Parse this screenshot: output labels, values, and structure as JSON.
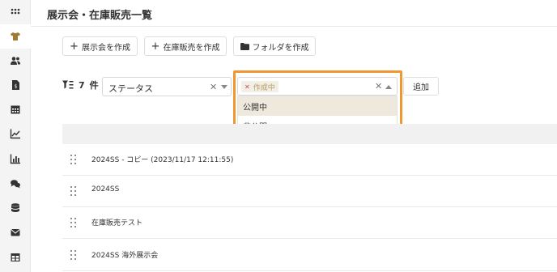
{
  "sidebar": {
    "items": [
      {
        "icon": "grid-icon"
      },
      {
        "icon": "tshirt-icon",
        "active": true
      },
      {
        "icon": "users-icon"
      },
      {
        "icon": "invoice-icon"
      },
      {
        "icon": "calendar-icon"
      },
      {
        "icon": "trend-chart-icon"
      },
      {
        "icon": "bar-chart-icon"
      },
      {
        "icon": "chat-icon"
      },
      {
        "icon": "database-icon"
      },
      {
        "icon": "mail-icon"
      },
      {
        "icon": "table-icon"
      }
    ],
    "accent": "#a07a35"
  },
  "header": {
    "title": "展示会・在庫販売一覧"
  },
  "toolbar": {
    "create_exhibition": "展示会を作成",
    "create_inventory": "在庫販売を作成",
    "create_folder": "フォルダを作成"
  },
  "filter": {
    "count": "7",
    "count_unit": "件",
    "status_placeholder": "ステータス",
    "selected_chip": "作成中",
    "options": [
      "公開中",
      "非公開"
    ],
    "add_label": "追加"
  },
  "rows": [
    "2024SS - コピー (2023/11/17 12:11:55)",
    "2024SS",
    "在庫販売テスト",
    "2024SS 海外展示会"
  ],
  "colors": {
    "highlight": "#f0982f",
    "chip_bg": "#f2efe6",
    "option_hover": "#efe9dd"
  }
}
